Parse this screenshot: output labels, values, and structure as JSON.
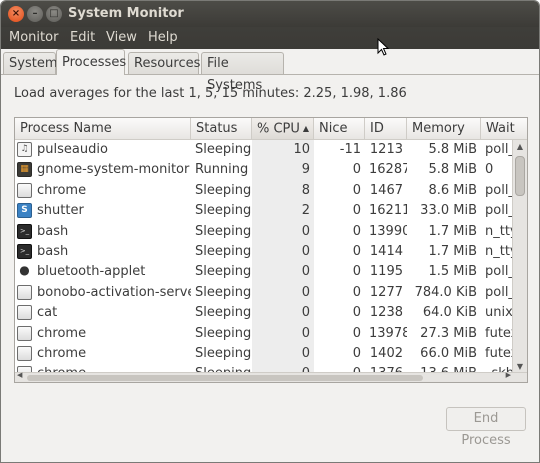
{
  "window": {
    "title": "System Monitor",
    "close_glyph": "×",
    "minimize_glyph": "–",
    "maximize_glyph": "□"
  },
  "menu": [
    "Monitor",
    "Edit",
    "View",
    "Help"
  ],
  "tabs": [
    {
      "label": "System",
      "active": false
    },
    {
      "label": "Processes",
      "active": true
    },
    {
      "label": "Resources",
      "active": false
    },
    {
      "label": "File Systems",
      "active": false
    }
  ],
  "load_averages": "Load averages for the last 1, 5, 15 minutes: 2.25, 1.98, 1.86",
  "columns": [
    "Process Name",
    "Status",
    "% CPU",
    "Nice",
    "ID",
    "Memory",
    "Waiting Channel"
  ],
  "columns_visible": [
    "Process Name",
    "Status",
    "% CPU",
    "Nice",
    "ID",
    "Memory",
    "Wait"
  ],
  "sort_column": "% CPU",
  "sort_indicator": "▲",
  "processes": [
    {
      "name": "pulseaudio",
      "icon": "pulseaudio-icon",
      "status": "Sleeping",
      "cpu": "10",
      "nice": "-11",
      "id": "1213",
      "memory": "5.8 MiB",
      "wait": "poll_"
    },
    {
      "name": "gnome-system-monitor",
      "icon": "system-monitor-icon",
      "status": "Running",
      "cpu": "9",
      "nice": "0",
      "id": "16287",
      "memory": "5.8 MiB",
      "wait": "0"
    },
    {
      "name": "chrome",
      "icon": "generic-process-icon",
      "status": "Sleeping",
      "cpu": "8",
      "nice": "0",
      "id": "1467",
      "memory": "8.6 MiB",
      "wait": "poll_"
    },
    {
      "name": "shutter",
      "icon": "shutter-icon",
      "status": "Sleeping",
      "cpu": "2",
      "nice": "0",
      "id": "16211",
      "memory": "33.0 MiB",
      "wait": "poll_"
    },
    {
      "name": "bash",
      "icon": "terminal-icon",
      "status": "Sleeping",
      "cpu": "0",
      "nice": "0",
      "id": "13990",
      "memory": "1.7 MiB",
      "wait": "n_tty"
    },
    {
      "name": "bash",
      "icon": "terminal-icon",
      "status": "Sleeping",
      "cpu": "0",
      "nice": "0",
      "id": "1414",
      "memory": "1.7 MiB",
      "wait": "n_tty"
    },
    {
      "name": "bluetooth-applet",
      "icon": "bluetooth-icon",
      "status": "Sleeping",
      "cpu": "0",
      "nice": "0",
      "id": "1195",
      "memory": "1.5 MiB",
      "wait": "poll_"
    },
    {
      "name": "bonobo-activation-server",
      "icon": "generic-process-icon",
      "status": "Sleeping",
      "cpu": "0",
      "nice": "0",
      "id": "1277",
      "memory": "784.0 KiB",
      "wait": "poll_"
    },
    {
      "name": "cat",
      "icon": "generic-process-icon",
      "status": "Sleeping",
      "cpu": "0",
      "nice": "0",
      "id": "1238",
      "memory": "64.0 KiB",
      "wait": "unix_"
    },
    {
      "name": "chrome",
      "icon": "generic-process-icon",
      "status": "Sleeping",
      "cpu": "0",
      "nice": "0",
      "id": "13978",
      "memory": "27.3 MiB",
      "wait": "futex"
    },
    {
      "name": "chrome",
      "icon": "generic-process-icon",
      "status": "Sleeping",
      "cpu": "0",
      "nice": "0",
      "id": "1402",
      "memory": "66.0 MiB",
      "wait": "futex"
    },
    {
      "name": "chrome",
      "icon": "generic-process-icon",
      "status": "Sleeping",
      "cpu": "0",
      "nice": "0",
      "id": "1376",
      "memory": "13.6 MiB",
      "wait": "_skb"
    }
  ],
  "end_process_label": "End Process",
  "end_process_enabled": false,
  "scroll_up_glyph": "▲",
  "scroll_down_glyph": "▼",
  "scroll_left_glyph": "◀",
  "scroll_right_glyph": "▶"
}
